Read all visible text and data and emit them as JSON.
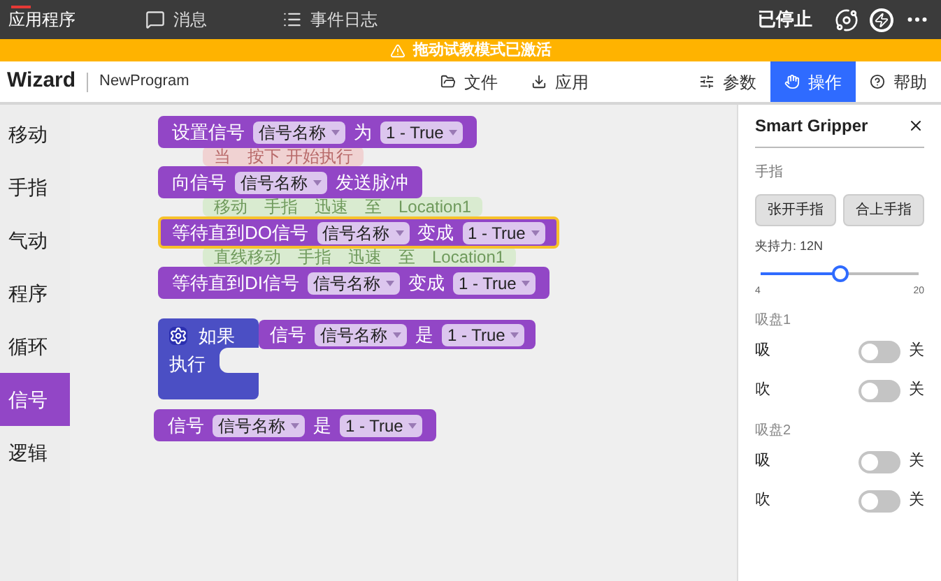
{
  "top_bar": {
    "tabs": [
      {
        "label": "应用程序",
        "selected": true
      },
      {
        "label": "消息",
        "selected": false
      },
      {
        "label": "事件日志",
        "selected": false
      }
    ],
    "status": "已停止"
  },
  "banner": {
    "text": "拖动试教模式已激活"
  },
  "toolbar": {
    "app_name": "Wizard",
    "program": "NewProgram",
    "center_buttons": [
      "文件",
      "应用"
    ],
    "right_tabs": [
      {
        "label": "参数",
        "selected": false
      },
      {
        "label": "操作",
        "selected": true
      },
      {
        "label": "帮助",
        "selected": false
      }
    ]
  },
  "categories": [
    {
      "label": "移动",
      "selected": false
    },
    {
      "label": "手指",
      "selected": false
    },
    {
      "label": "气动",
      "selected": false
    },
    {
      "label": "程序",
      "selected": false
    },
    {
      "label": "循环",
      "selected": false
    },
    {
      "label": "信号",
      "selected": true
    },
    {
      "label": "逻辑",
      "selected": false
    }
  ],
  "background_blocks": [
    {
      "color": "#f0d2d2",
      "pieces": [
        "当",
        "按下 开始执行"
      ]
    },
    {
      "color": "#d9ebd0",
      "pieces": [
        "移动",
        "手指",
        "迅速",
        "至",
        "Location1"
      ]
    },
    {
      "color": "#d9ebd0",
      "pieces": [
        "直线移动",
        "手指",
        "迅速",
        "至",
        "Location1"
      ]
    }
  ],
  "blocks": [
    {
      "kind": "statement",
      "highlighted": false,
      "pieces": [
        {
          "kind": "text",
          "text": "设置信号"
        },
        {
          "kind": "dropdown",
          "text": "信号名称"
        },
        {
          "kind": "text",
          "text": "为"
        },
        {
          "kind": "dropdown",
          "text": "1 - True"
        }
      ]
    },
    {
      "kind": "statement",
      "highlighted": false,
      "pieces": [
        {
          "kind": "text",
          "text": "向信号"
        },
        {
          "kind": "dropdown",
          "text": "信号名称"
        },
        {
          "kind": "text",
          "text": "发送脉冲"
        }
      ]
    },
    {
      "kind": "statement",
      "highlighted": true,
      "pieces": [
        {
          "kind": "text",
          "text": "等待直到DO信号"
        },
        {
          "kind": "dropdown",
          "text": "信号名称"
        },
        {
          "kind": "text",
          "text": "变成"
        },
        {
          "kind": "dropdown",
          "text": "1 - True"
        }
      ]
    },
    {
      "kind": "statement",
      "highlighted": false,
      "pieces": [
        {
          "kind": "text",
          "text": "等待直到DI信号"
        },
        {
          "kind": "dropdown",
          "text": "信号名称"
        },
        {
          "kind": "text",
          "text": "变成"
        },
        {
          "kind": "dropdown",
          "text": "1 - True"
        }
      ]
    },
    {
      "kind": "if",
      "highlighted": false,
      "label": "如果",
      "do_label": "执行",
      "pieces": [
        {
          "kind": "text",
          "text": "信号"
        },
        {
          "kind": "dropdown",
          "text": "信号名称"
        },
        {
          "kind": "text",
          "text": "是"
        },
        {
          "kind": "dropdown",
          "text": "1 - True"
        }
      ]
    },
    {
      "kind": "value",
      "highlighted": false,
      "pieces": [
        {
          "kind": "text",
          "text": "信号"
        },
        {
          "kind": "dropdown",
          "text": "信号名称"
        },
        {
          "kind": "text",
          "text": "是"
        },
        {
          "kind": "dropdown",
          "text": "1 - True"
        }
      ]
    }
  ],
  "panel": {
    "title": "Smart Gripper",
    "finger_label": "手指",
    "buttons": [
      "张开手指",
      "合上手指"
    ],
    "force": {
      "label": "夹持力: 12N",
      "level": 0.5,
      "min": "4",
      "max": "20"
    },
    "groups": [
      {
        "title": "吸盘1",
        "rows": [
          {
            "label": "吸",
            "on": false,
            "state": "关"
          },
          {
            "label": "吹",
            "on": false,
            "state": "关"
          }
        ]
      },
      {
        "title": "吸盘2",
        "rows": [
          {
            "label": "吸",
            "on": false,
            "state": "关"
          },
          {
            "label": "吹",
            "on": false,
            "state": "关"
          }
        ]
      }
    ]
  }
}
